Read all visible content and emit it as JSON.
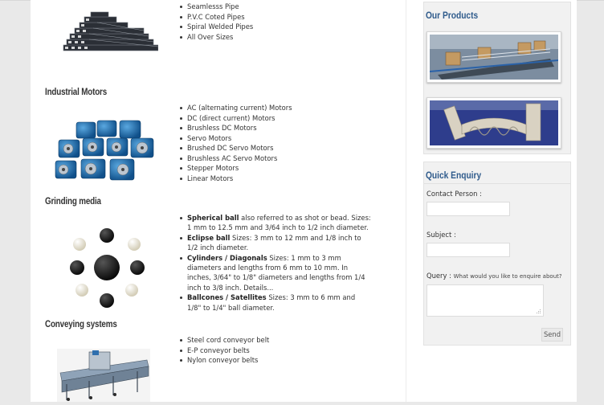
{
  "main": {
    "pipes": {
      "items": [
        "Seamlesss Pipe",
        "P.V.C Coted Pipes",
        "Spiral Welded Pipes",
        "All Over Sizes"
      ]
    },
    "motors": {
      "title": "Industrial Motors",
      "items": [
        "AC (alternating current) Motors",
        "DC (direct current) Motors",
        "Brushless DC Motors",
        "Servo Motors",
        "Brushed DC Servo Motors",
        "Brushless AC Servo Motors",
        "Stepper Motors",
        "Linear Motors"
      ]
    },
    "grinding": {
      "title": "Grinding media",
      "items": [
        {
          "bold": "Spherical ball",
          "text": " also referred to as shot or bead. Sizes: 1 mm to 12.5 mm and 3/64 inch to 1/2 inch diameter."
        },
        {
          "bold": "Eclipse ball",
          "text": " Sizes: 3 mm to 12 mm and 1/8 inch to 1/2 inch diameter."
        },
        {
          "bold": "Cylinders / Diagonals",
          "text": " Sizes: 1 mm to 3 mm diameters and lengths from 6 mm to 10 mm. In inches, 3/64\" to 1/8\" diameters and lengths from 1/4 inch to 3/8 inch. Details..."
        },
        {
          "bold": "Ballcones / Satellites",
          "text": " Sizes: 3 mm to 6 mm and 1/8\" to 1/4\" ball diameter."
        }
      ]
    },
    "conveying": {
      "title": "Conveying systems",
      "items": [
        "Steel cord conveyor belt",
        "E-P conveyor belts",
        "Nylon conveyor belts"
      ]
    }
  },
  "sidebar": {
    "products": {
      "title": "Our Products"
    },
    "enquiry": {
      "title": "Quick Enquiry",
      "contact_label": "Contact Person :",
      "subject_label": "Subject :",
      "query_label": "Query :",
      "query_hint": "What would you like to enquire about?",
      "send_label": "Send"
    }
  },
  "colors": {
    "sidebar_heading": "#2f5b8c",
    "motor_blue": "#1f6fb0",
    "page_bg": "#e9e9e9"
  }
}
